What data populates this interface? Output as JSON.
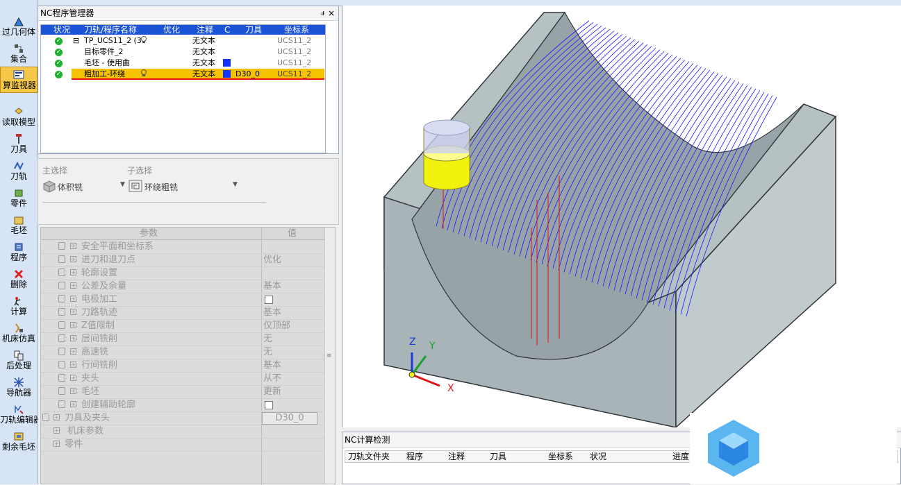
{
  "left_toolbar": {
    "items": [
      {
        "label": "过几何体"
      },
      {
        "label": "集合"
      },
      {
        "label": "算监视器"
      },
      {
        "label": "读取模型"
      },
      {
        "label": "刀具"
      },
      {
        "label": "刀轨"
      },
      {
        "label": "零件"
      },
      {
        "label": "毛坯"
      },
      {
        "label": "程序"
      },
      {
        "label": "删除"
      },
      {
        "label": "计算"
      },
      {
        "label": "机床仿真"
      },
      {
        "label": "后处理"
      },
      {
        "label": "导航器"
      },
      {
        "label": "刀轨编辑器"
      },
      {
        "label": "剩余毛坯"
      }
    ]
  },
  "nc_manager": {
    "title": "NC程序管理器",
    "pin_glyph": "ⅎ",
    "close_glyph": "×",
    "columns": [
      "状况",
      "刀轨/程序名称",
      "优化",
      "注释",
      "C",
      "刀具",
      "坐标系"
    ],
    "rows": [
      {
        "expander": "⊟",
        "name": "TP_UCS11_2 (3",
        "comment": "无文本",
        "tool": "",
        "ucs": "UCS11_2"
      },
      {
        "expander": "",
        "name": "目标零件_2",
        "comment": "无文本",
        "tool": "",
        "ucs": "UCS11_2"
      },
      {
        "expander": "",
        "name": "毛坯 - 使用曲",
        "comment": "无文本",
        "tool": "",
        "ucs": "UCS11_2"
      },
      {
        "expander": "",
        "name": "粗加工-环绕",
        "comment": "无文本",
        "tool": "D30_0",
        "ucs": "UCS11_2"
      }
    ]
  },
  "selection": {
    "main_label": "主选择",
    "sub_label": "子选择",
    "main_value": "体积铣",
    "sub_value": "环绕粗铣"
  },
  "params": {
    "col_param": "参数",
    "col_value": "值",
    "rows": [
      {
        "name": "安全平面和坐标系",
        "value": ""
      },
      {
        "name": "进刀和退刀点",
        "value": "优化"
      },
      {
        "name": "轮廓设置",
        "value": ""
      },
      {
        "name": "公差及余量",
        "value": "基本"
      },
      {
        "name": "电极加工",
        "value": ""
      },
      {
        "name": "刀路轨迹",
        "value": "基本"
      },
      {
        "name": "Z值限制",
        "value": "仅顶部"
      },
      {
        "name": "层间铣削",
        "value": "无"
      },
      {
        "name": "高速铣",
        "value": "无"
      },
      {
        "name": "行间铣削",
        "value": "基本"
      },
      {
        "name": "夹头",
        "value": "从不"
      },
      {
        "name": "毛坯",
        "value": "更新"
      },
      {
        "name": "创建辅助轮廓",
        "value": ""
      }
    ],
    "group_tool": "刀具及夹头",
    "group_tool_value": "D30_0",
    "group_machine": "机床参数",
    "group_part": "零件"
  },
  "viewport": {
    "axis_x": "X",
    "axis_y": "Y",
    "axis_z": "Z"
  },
  "calc_panel": {
    "title": "NC计算检测",
    "columns": [
      "刀轨文件夹",
      "程序",
      "注释",
      "刀具",
      "坐标系",
      "状况",
      "进度"
    ]
  },
  "colors": {
    "selected_row": "#f5c200",
    "selected_border": "#e0141a",
    "header_blue": "#1c54d8",
    "toolpath": "#1a1aff",
    "part": "#a9b5b9",
    "tool": "#f2f20f"
  }
}
